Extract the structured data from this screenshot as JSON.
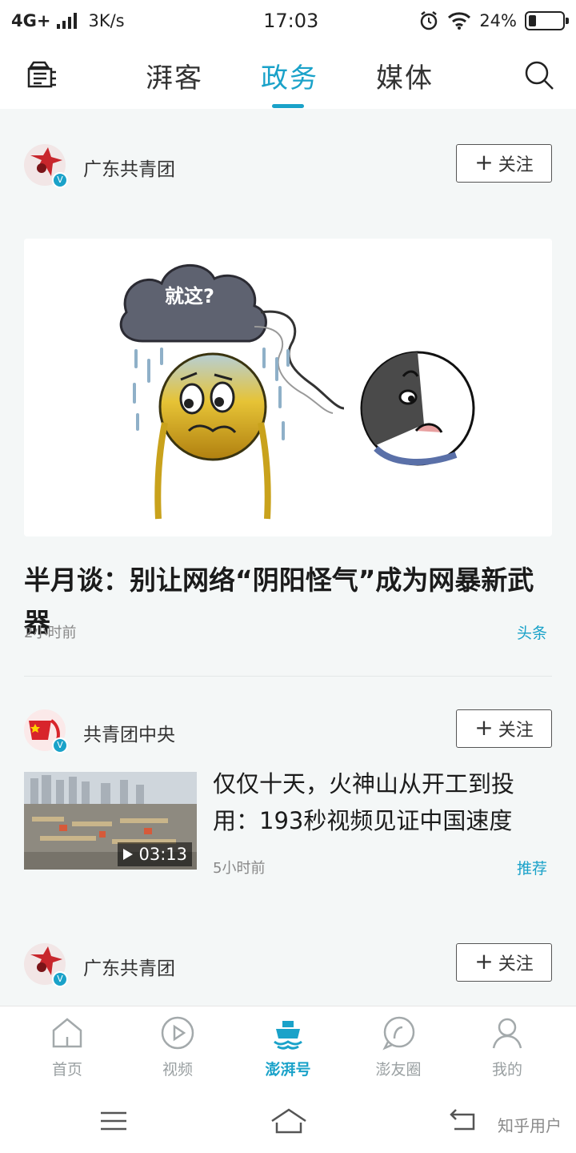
{
  "status_bar": {
    "network": "4G+",
    "speed": "3K/s",
    "time": "17:03",
    "battery": "24%",
    "battery_level": 0.24
  },
  "top_nav": {
    "tabs": [
      {
        "label": "湃客",
        "active": false
      },
      {
        "label": "政务",
        "active": true
      },
      {
        "label": "媒体",
        "active": false
      }
    ],
    "left_icon": "ship-list-icon",
    "right_icon": "search-icon"
  },
  "feed": [
    {
      "author": "广东共青团",
      "follow_label": "关注",
      "title": "半月谈：别让网络“阴阳怪气”成为网暴新武器",
      "time": "2小时前",
      "tag": "头条",
      "image_text": "就这?"
    },
    {
      "author": "共青团中央",
      "follow_label": "关注",
      "title": "仅仅十天，火神山从开工到投用：193秒视频见证中国速度",
      "time": "5小时前",
      "tag": "推荐",
      "duration": "03:13"
    },
    {
      "author": "广东共青团",
      "follow_label": "关注"
    }
  ],
  "bottom_tabs": [
    {
      "label": "首页",
      "icon": "home-icon",
      "active": false
    },
    {
      "label": "视频",
      "icon": "video-play-icon",
      "active": false
    },
    {
      "label": "澎湃号",
      "icon": "ship-icon",
      "active": true
    },
    {
      "label": "澎友圈",
      "icon": "chat-bubble-icon",
      "active": false
    },
    {
      "label": "我的",
      "icon": "user-icon",
      "active": false
    }
  ],
  "watermark": "知乎用户",
  "colors": {
    "accent": "#1aa2c9",
    "background": "#f4f7f7"
  }
}
